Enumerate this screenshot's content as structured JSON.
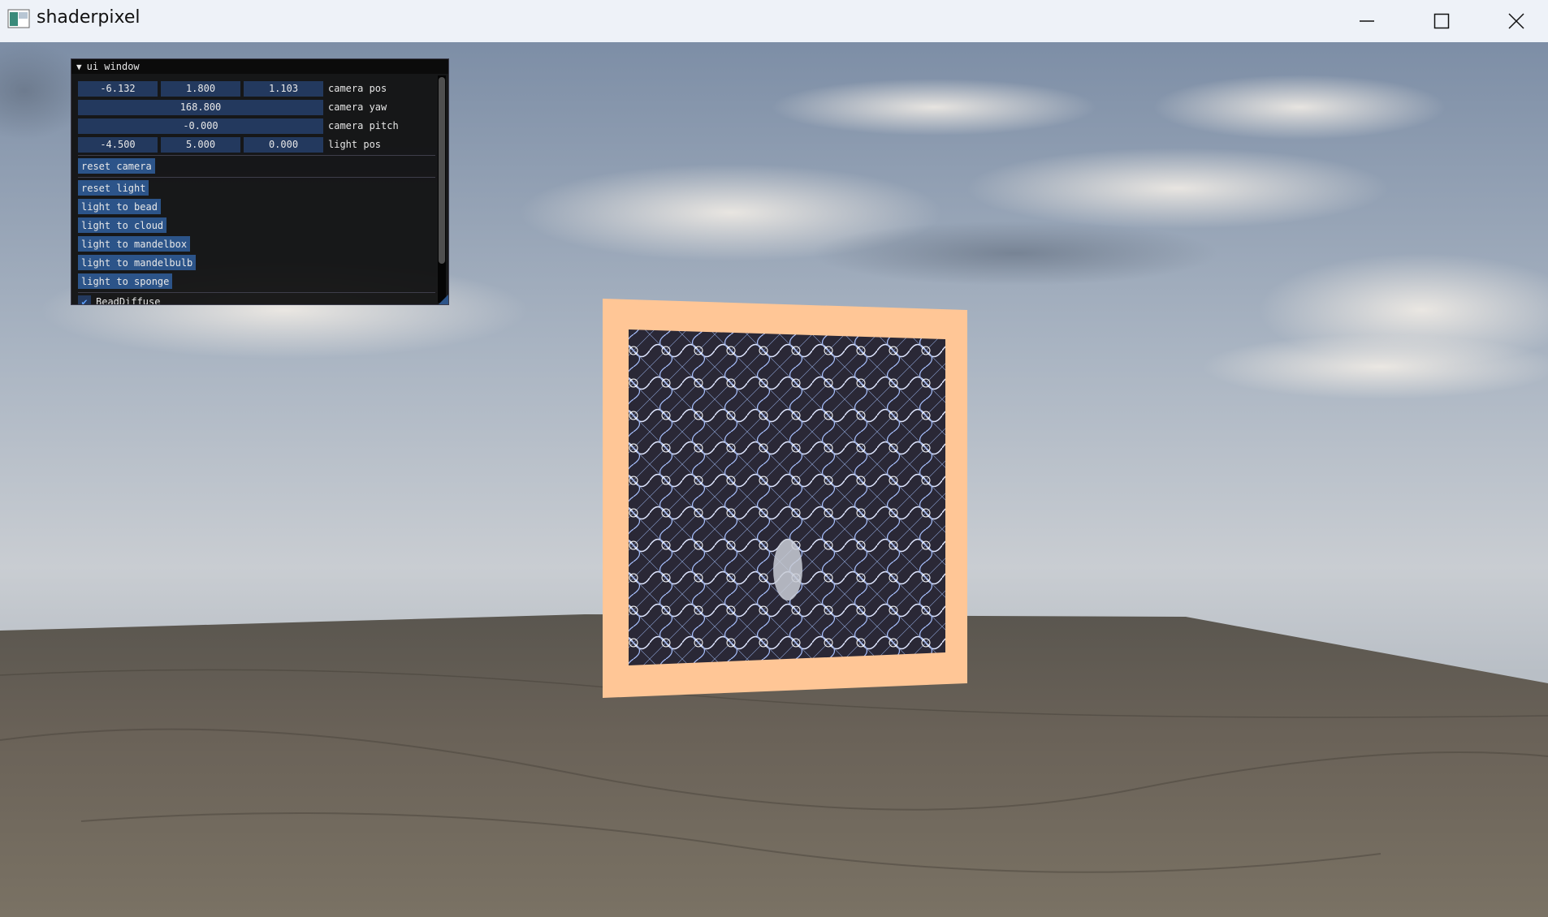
{
  "window": {
    "title": "shaderpixel",
    "controls": {
      "minimize": "minimize-icon",
      "maximize": "maximize-icon",
      "close": "close-icon"
    }
  },
  "ui_window": {
    "title": "ui window",
    "camera_pos": {
      "label": "camera pos",
      "values": [
        "-6.132",
        "1.800",
        "1.103"
      ]
    },
    "camera_yaw": {
      "label": "camera yaw",
      "value": "168.800"
    },
    "camera_pitch": {
      "label": "camera pitch",
      "value": "-0.000"
    },
    "light_pos": {
      "label": "light pos",
      "values": [
        "-4.500",
        "5.000",
        "0.000"
      ]
    },
    "buttons": {
      "reset_camera": "reset camera",
      "reset_light": "reset light",
      "light_to_bead": "light to bead",
      "light_to_cloud": "light to cloud",
      "light_to_mandelbox": "light to mandelbox",
      "light_to_mandelbulb": "light to mandelbulb",
      "light_to_sponge": "light to sponge"
    },
    "checkbox": {
      "label": "BeadDiffuse",
      "checked": true
    }
  },
  "colors": {
    "frame": "#ffc696",
    "button": "#2c5489",
    "field": "#23395e"
  }
}
